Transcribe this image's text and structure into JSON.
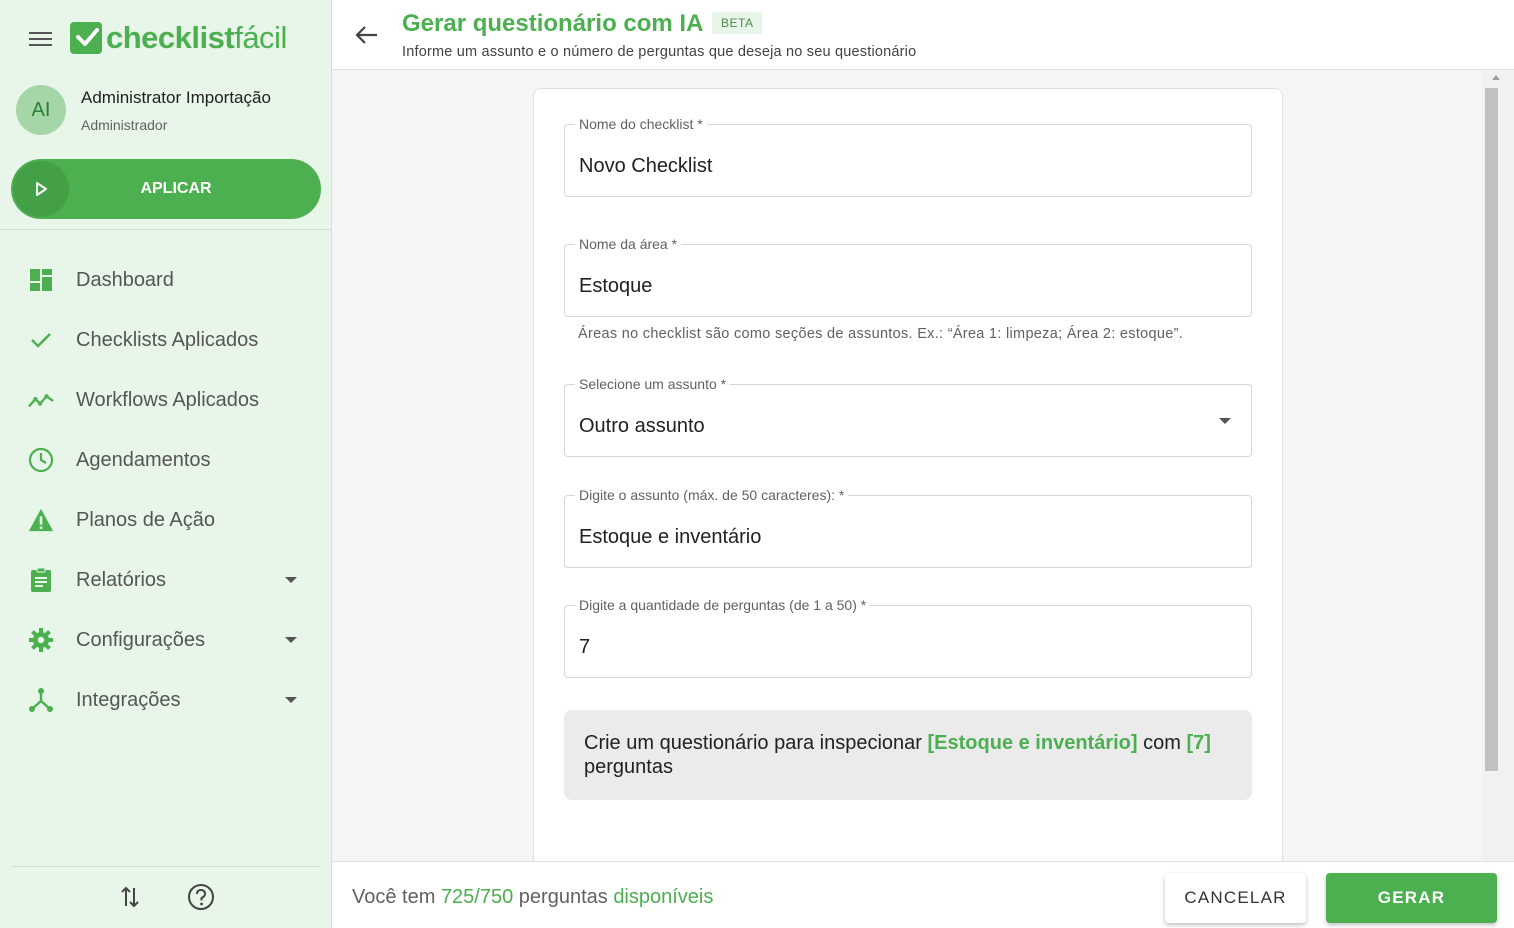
{
  "app": {
    "logo_bold": "checklist",
    "logo_light": "fácil",
    "brand_color": "#4caf50"
  },
  "user": {
    "initials": "AI",
    "name": "Administrator Importação",
    "role": "Administrador"
  },
  "apply_button": {
    "label": "APLICAR"
  },
  "nav": {
    "items": [
      {
        "label": "Dashboard",
        "icon": "dashboard-icon"
      },
      {
        "label": "Checklists Aplicados",
        "icon": "check-icon"
      },
      {
        "label": "Workflows Aplicados",
        "icon": "trending-icon"
      },
      {
        "label": "Agendamentos",
        "icon": "clock-icon"
      },
      {
        "label": "Planos de Ação",
        "icon": "warning-icon"
      },
      {
        "label": "Relatórios",
        "icon": "clipboard-icon",
        "expandable": true
      },
      {
        "label": "Configurações",
        "icon": "gear-icon",
        "expandable": true
      },
      {
        "label": "Integrações",
        "icon": "integration-icon",
        "expandable": true
      }
    ]
  },
  "header": {
    "title": "Gerar questionário com IA",
    "badge": "BETA",
    "subtitle": "Informe um assunto e o número de perguntas que deseja no seu questionário"
  },
  "form": {
    "checklist_name": {
      "label": "Nome do checklist *",
      "value": "Novo Checklist"
    },
    "area_name": {
      "label": "Nome da área *",
      "value": "Estoque"
    },
    "area_helper": "Áreas no checklist são como seções de assuntos. Ex.: “Área 1: limpeza; Área 2: estoque”.",
    "subject_select": {
      "label": "Selecione um assunto *",
      "value": "Outro assunto"
    },
    "subject_text": {
      "label": "Digite o assunto (máx. de 50 caracteres): *",
      "value": "Estoque e inventário"
    },
    "question_count": {
      "label": "Digite a quantidade de perguntas (de 1 a 50) *",
      "value": "7"
    }
  },
  "summary": {
    "prefix": "Crie um questionário para inspecionar ",
    "subject": "[Estoque e inventário]",
    "middle": " com ",
    "count": "[7]",
    "suffix": " perguntas"
  },
  "footer": {
    "prefix": "Você tem ",
    "quota": "725/750",
    "middle": " perguntas ",
    "available": "disponíveis",
    "cancel_label": "CANCELAR",
    "generate_label": "GERAR"
  }
}
